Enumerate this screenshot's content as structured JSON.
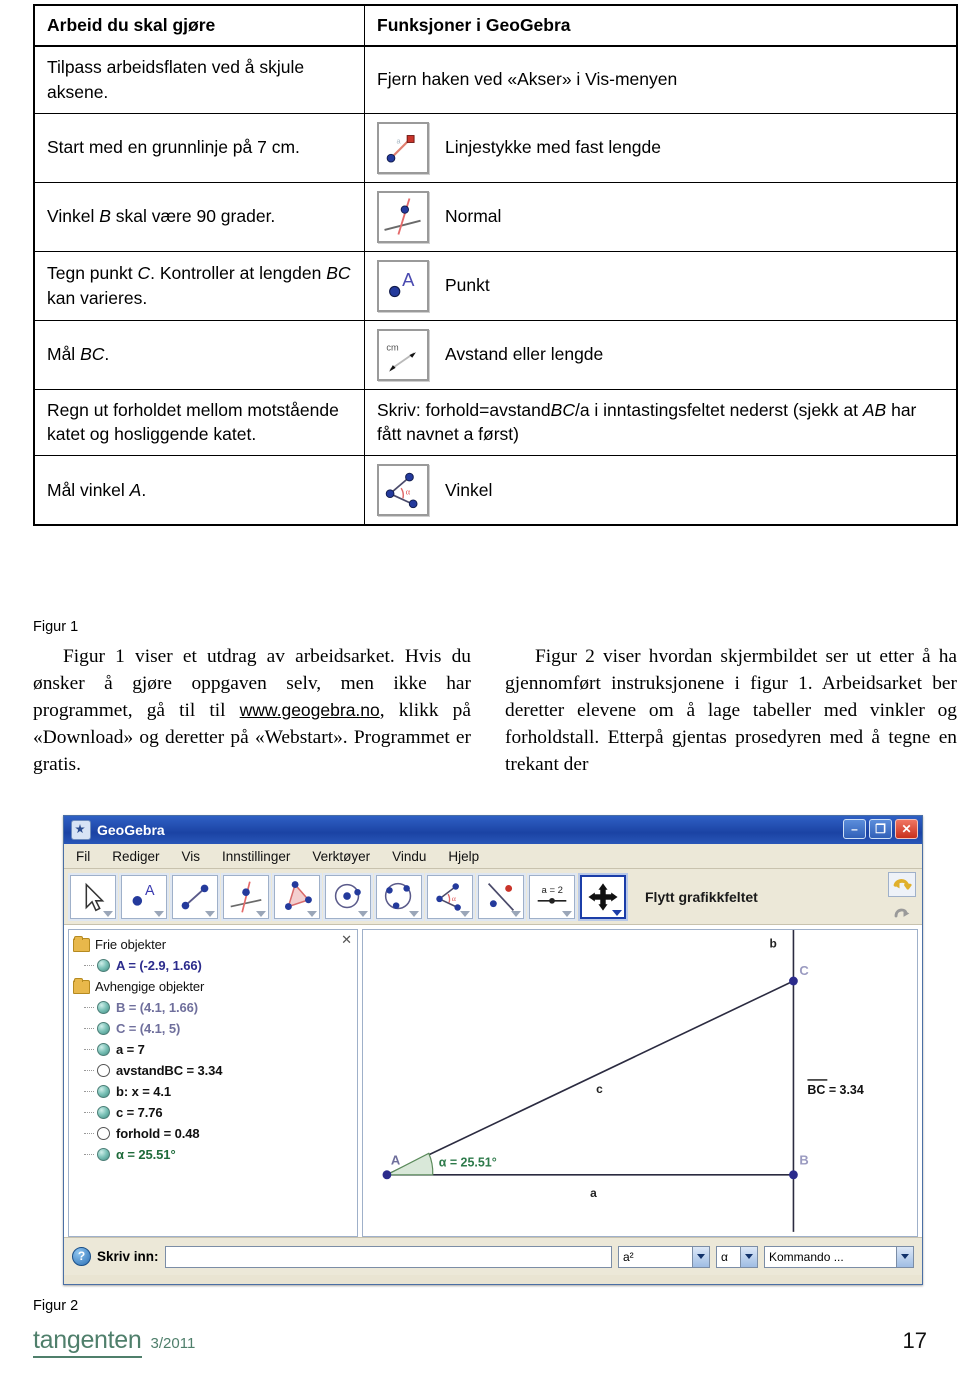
{
  "worksheet": {
    "headers": [
      "Arbeid du skal gjøre",
      "Funksjoner i GeoGebra"
    ],
    "rows": [
      {
        "task": "Tilpass arbeidsflaten ved å skjule aksene.",
        "func": "Fjern haken ved «Akser» i Vis-menyen",
        "icon": ""
      },
      {
        "task": "Start med en grunnlinje på 7 cm.",
        "func": "Linjestykke med fast lengde",
        "icon": "segment-fixed-length-icon"
      },
      {
        "task_pre": "Vinkel ",
        "task_it": "B",
        "task_post": " skal være 90 grader.",
        "func": "Normal",
        "icon": "perpendicular-line-icon"
      },
      {
        "task_pre": "Tegn punkt ",
        "task_it": "C",
        "task_post": ". Kontroller at lengden ",
        "task_it2": "BC",
        "task_post2": " kan varieres.",
        "func": "Punkt",
        "icon": "point-icon"
      },
      {
        "task_pre": "Mål ",
        "task_it": "BC",
        "task_post": ".",
        "func": "Avstand eller lengde",
        "icon": "distance-length-icon"
      },
      {
        "task": "Regn ut forholdet mellom motstående katet og hosliggende katet.",
        "func_pre": "Skriv: forhold=avstand",
        "func_it": "BC",
        "func_mid": "/a i inntastingsfeltet nederst (sjekk at ",
        "func_it2": "AB",
        "func_post": " har fått navnet a først)",
        "icon": ""
      },
      {
        "task_pre": "Mål vinkel ",
        "task_it": "A",
        "task_post": ".",
        "func": "Vinkel",
        "icon": "angle-icon"
      }
    ]
  },
  "captions": {
    "figur1": "Figur 1",
    "figur2": "Figur 2"
  },
  "body": {
    "left": {
      "part1": "Figur 1 viser et utdrag av arbeidsarket. Hvis du ønsker å gjøre oppgaven selv, men ikke har programmet, gå til til ",
      "link": "www.geogebra.no",
      "part2": ", klikk på «Download» og deretter på «Webstart». Programmet er gratis."
    },
    "right": {
      "text": "Figur 2 viser hvordan skjermbildet ser ut etter å ha gjennomført instruksjonene i figur 1. Arbeidsarket ber deretter elevene om å lage tabeller med vinkler og forholdstall. Etterpå gjentas prosedyren med å tegne en trekant der"
    }
  },
  "geogebra": {
    "title": "GeoGebra",
    "window_buttons": {
      "minimize": "–",
      "maximize": "❐",
      "close": "✕"
    },
    "menu": [
      "Fil",
      "Rediger",
      "Vis",
      "Innstillinger",
      "Verktøyer",
      "Vindu",
      "Hjelp"
    ],
    "tools": [
      "move-pointer-tool",
      "point-tool",
      "segment-tool",
      "perpendicular-line-tool",
      "polygon-tool",
      "circle-center-point-tool",
      "circle-through-3-points-tool",
      "angle-tool",
      "reflect-about-line-tool",
      "slider-tool",
      "move-graphics-view-tool"
    ],
    "tool_hint": "Flytt grafikkfeltet",
    "undo_icon": "undo-icon",
    "redo_icon": "redo-icon",
    "algebra": {
      "free_objects_label": "Frie objekter",
      "dependent_objects_label": "Avhengige objekter",
      "free_objects": [
        {
          "text": "A = (-2.9, 1.66)",
          "style": "blue",
          "filled": true
        }
      ],
      "dependent_objects": [
        {
          "text": "B = (4.1, 1.66)",
          "style": "dim",
          "filled": true
        },
        {
          "text": "C = (4.1, 5)",
          "style": "dim",
          "filled": true
        },
        {
          "text": "a = 7",
          "style": "black",
          "filled": true
        },
        {
          "text": "avstandBC = 3.34",
          "style": "black",
          "filled": false
        },
        {
          "text": "b: x = 4.1",
          "style": "black",
          "filled": true
        },
        {
          "text": "c = 7.76",
          "style": "black",
          "filled": true
        },
        {
          "text": "forhold = 0.48",
          "style": "black",
          "filled": false
        },
        {
          "text": "α = 25.51°",
          "style": "green",
          "filled": true
        }
      ]
    },
    "graphics": {
      "label_A": "A",
      "label_B": "B",
      "label_C": "C",
      "label_a": "a",
      "label_b": "b",
      "label_c": "c",
      "angle_label": "α = 25.51°",
      "segment_label": "BC = 3.34"
    },
    "input_bar": {
      "help_icon": "?",
      "label": "Skriv inn:",
      "value": "",
      "superscript_combo": "a²",
      "alpha_combo": "α",
      "command_combo": "Kommando ..."
    }
  },
  "footer": {
    "brand": "tangenten",
    "issue": "3/2011",
    "page": "17"
  },
  "colors": {
    "brand_green": "#4f7f6b",
    "title_blue": "#1b43a4",
    "point_blue": "#2b2b8c",
    "accent_red": "#d04a4a"
  }
}
